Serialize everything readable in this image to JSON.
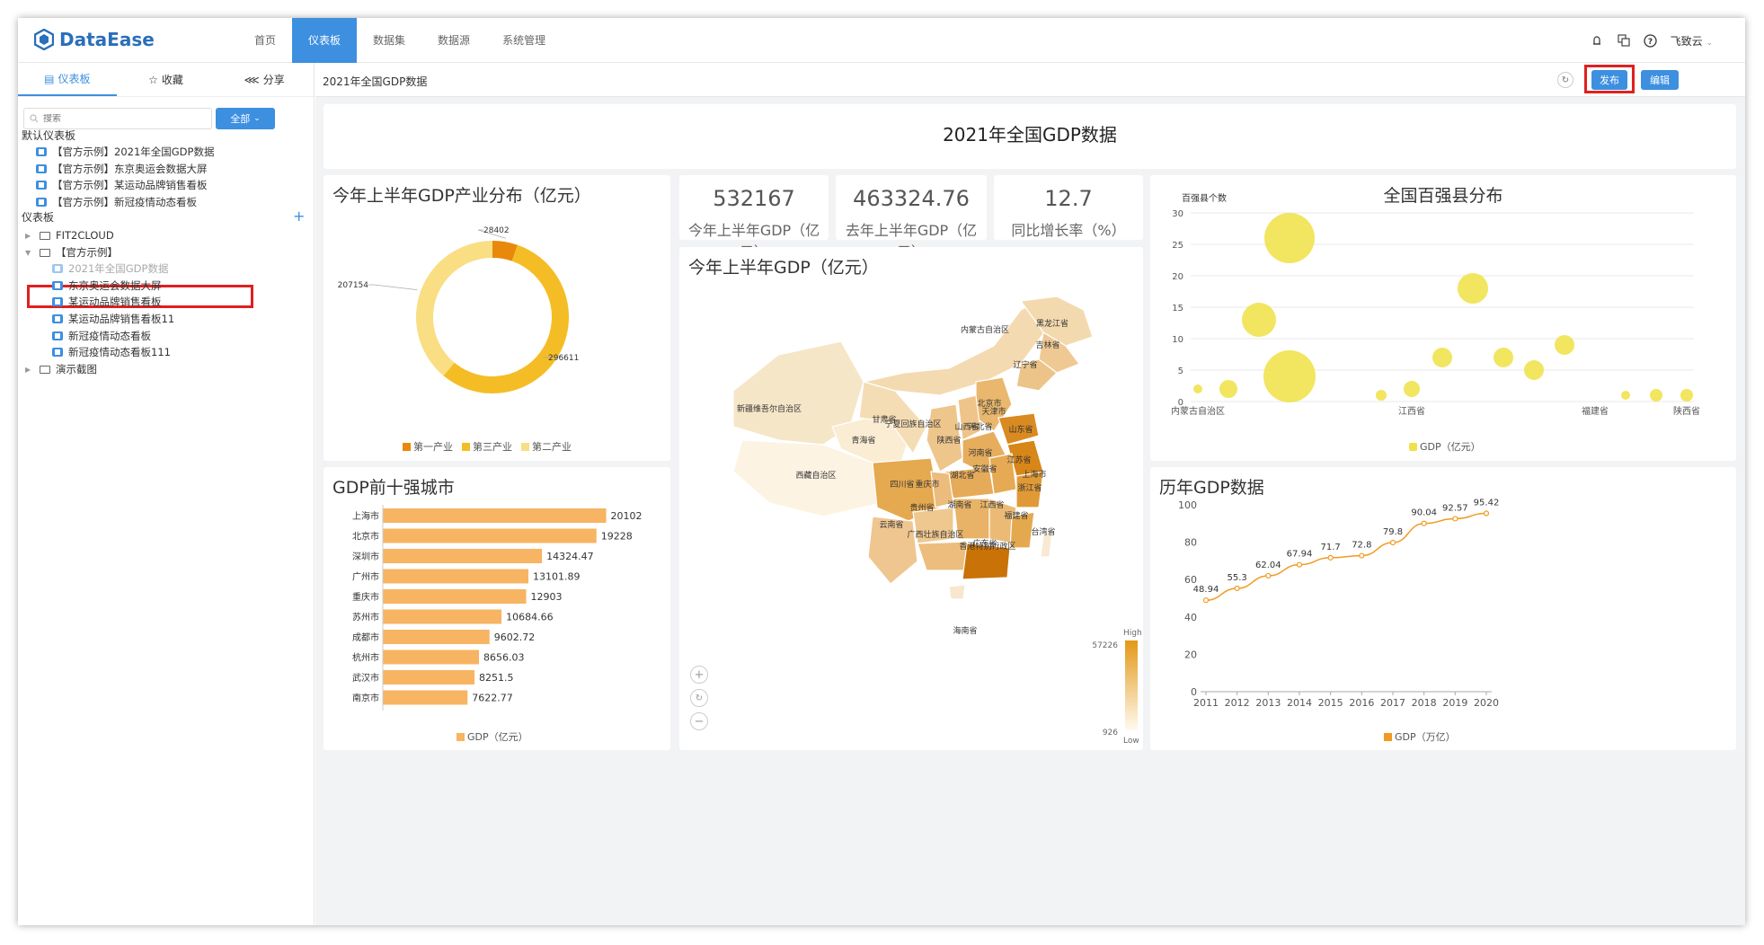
{
  "app": {
    "name": "DataEase",
    "user": "飞致云",
    "brand_color": "#3d8fe0"
  },
  "nav": {
    "items": [
      "首页",
      "仪表板",
      "数据集",
      "数据源",
      "系统管理"
    ],
    "active": "仪表板"
  },
  "header_icons": [
    "notification-icon",
    "translate-icon",
    "help-icon"
  ],
  "sidebar": {
    "tabs": [
      {
        "label": "仪表板",
        "icon": "dashboard-icon"
      },
      {
        "label": "收藏",
        "icon": "star-icon"
      },
      {
        "label": "分享",
        "icon": "share-icon"
      }
    ],
    "search_placeholder": "搜索",
    "filter_label": "全部",
    "default_section": "默认仪表板",
    "default_items": [
      "【官方示例】2021年全国GDP数据",
      "【官方示例】东京奥运会数据大屏",
      "【官方示例】某运动品牌销售看板",
      "【官方示例】新冠疫情动态看板"
    ],
    "dash_section": "仪表板",
    "folders": [
      {
        "label": "FIT2CLOUD"
      },
      {
        "label": "【官方示例】",
        "children": [
          "2021年全国GDP数据",
          "东京奥运会数据大屏",
          "某运动品牌销售看板",
          "某运动品牌销售看板11",
          "新冠疫情动态看板",
          "新冠疫情动态看板111"
        ]
      },
      {
        "label": "演示截图"
      }
    ],
    "selected": "2021年全国GDP数据"
  },
  "content": {
    "title": "2021年全国GDP数据",
    "publish_label": "发布",
    "edit_label": "编辑",
    "main_title": "2021年全国GDP数据"
  },
  "kpis": [
    {
      "value": "532167",
      "label": "今年上半年GDP（亿元）"
    },
    {
      "value": "463324.76",
      "label": "去年上半年GDP（亿元）"
    },
    {
      "value": "12.7",
      "label": "同比增长率（%）"
    }
  ],
  "chart_titles": {
    "pie": "今年上半年GDP产业分布（亿元）",
    "map": "今年上半年GDP（亿元）",
    "bubble": "全国百强县分布",
    "bar": "GDP前十强城市",
    "line": "历年GDP数据"
  },
  "map": {
    "provinces": [
      "内蒙古自治区",
      "黑龙江省",
      "吉林省",
      "辽宁省",
      "新疆维吾尔自治区",
      "北京市",
      "天津市",
      "河北省",
      "山西省",
      "山东省",
      "甘肃省",
      "宁夏回族自治区",
      "陕西省",
      "青海省",
      "河南省",
      "江苏省",
      "安徽省",
      "上海市",
      "湖北省",
      "浙江省",
      "西藏自治区",
      "四川省",
      "重庆市",
      "湖南省",
      "江西省",
      "贵州省",
      "福建省",
      "云南省",
      "广西壮族自治区",
      "广东省",
      "香港特别行政区",
      "台湾省",
      "海南省"
    ],
    "visual_map": {
      "high_label": "High",
      "low_label": "Low",
      "max": "57226",
      "min": "926"
    },
    "zoom_controls": [
      "zoom-in-icon",
      "reset-icon",
      "zoom-out-icon"
    ]
  },
  "chart_data": [
    {
      "type": "pie",
      "title": "今年上半年GDP产业分布（亿元）",
      "slices": [
        {
          "name": "第一产业",
          "value": 28402,
          "color": "#e8890c"
        },
        {
          "name": "第三产业",
          "value": 296611,
          "color": "#f5bd25"
        },
        {
          "name": "第二产业",
          "value": 207154,
          "color": "#f9de84"
        }
      ],
      "legend_position": "bottom"
    },
    {
      "type": "scatter",
      "title": "全国百强县分布",
      "ylabel": "百强县个数",
      "ylim": [
        0,
        30
      ],
      "yticks": [
        0,
        5,
        10,
        15,
        20,
        25,
        30
      ],
      "x_tick_labels": [
        "内蒙古自治区",
        "江西省",
        "福建省",
        "陕西省"
      ],
      "series": [
        {
          "name": "GDP（亿元）",
          "color": "#f0e14a",
          "points": [
            {
              "x": 0,
              "y": 2,
              "size": 5
            },
            {
              "x": 1,
              "y": 2,
              "size": 10
            },
            {
              "x": 2,
              "y": 13,
              "size": 19
            },
            {
              "x": 3,
              "y": 26,
              "size": 28
            },
            {
              "x": 3,
              "y": 4,
              "size": 29
            },
            {
              "x": 6,
              "y": 1,
              "size": 6
            },
            {
              "x": 7,
              "y": 2,
              "size": 9
            },
            {
              "x": 8,
              "y": 7,
              "size": 11
            },
            {
              "x": 9,
              "y": 18,
              "size": 17
            },
            {
              "x": 10,
              "y": 7,
              "size": 11
            },
            {
              "x": 11,
              "y": 5,
              "size": 11
            },
            {
              "x": 12,
              "y": 9,
              "size": 11
            },
            {
              "x": 14,
              "y": 1,
              "size": 5
            },
            {
              "x": 15,
              "y": 1,
              "size": 7
            },
            {
              "x": 16,
              "y": 1,
              "size": 7
            }
          ]
        }
      ],
      "legend_position": "bottom"
    },
    {
      "type": "bar",
      "title": "GDP前十强城市",
      "orientation": "horizontal",
      "categories": [
        "上海市",
        "北京市",
        "深圳市",
        "广州市",
        "重庆市",
        "苏州市",
        "成都市",
        "杭州市",
        "武汉市",
        "南京市"
      ],
      "values": [
        20102,
        19228,
        14324.47,
        13101.89,
        12903,
        10684.66,
        9602.72,
        8656.03,
        8251.5,
        7622.77
      ],
      "value_labels": [
        "20102",
        "19228",
        "14324.47",
        "13101.89",
        "12903",
        "10684.66",
        "9602.72",
        "8656.03",
        "8251.5",
        "7622.77"
      ],
      "series_name": "GDP（亿元）",
      "color": "#f7b462",
      "legend_position": "bottom"
    },
    {
      "type": "line",
      "title": "历年GDP数据",
      "x": [
        "2011",
        "2012",
        "2013",
        "2014",
        "2015",
        "2016",
        "2017",
        "2018",
        "2019",
        "2020"
      ],
      "values": [
        48.94,
        55.3,
        62.04,
        67.94,
        71.7,
        72.8,
        79.8,
        90.04,
        92.57,
        95.42
      ],
      "value_labels": [
        "48.94",
        "55.3",
        "62.04",
        "67.94",
        "71.7",
        "72.8",
        "79.8",
        "90.04",
        "92.57",
        "95.42"
      ],
      "ylim": [
        0,
        100
      ],
      "yticks": [
        0,
        20,
        40,
        60,
        80,
        100
      ],
      "series_name": "GDP（万亿）",
      "color": "#f19a1f",
      "legend_position": "bottom"
    }
  ]
}
